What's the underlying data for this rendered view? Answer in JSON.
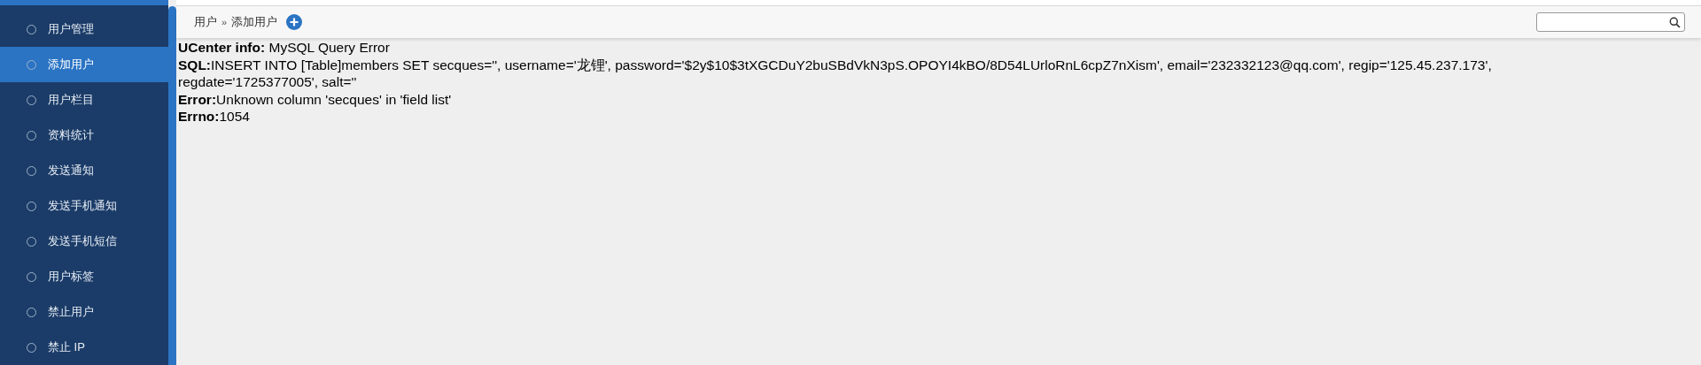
{
  "sidebar": {
    "items": [
      {
        "label": "用户管理",
        "selected": false
      },
      {
        "label": "添加用户",
        "selected": true
      },
      {
        "label": "用户栏目",
        "selected": false
      },
      {
        "label": "资料统计",
        "selected": false
      },
      {
        "label": "发送通知",
        "selected": false
      },
      {
        "label": "发送手机通知",
        "selected": false
      },
      {
        "label": "发送手机短信",
        "selected": false
      },
      {
        "label": "用户标签",
        "selected": false
      },
      {
        "label": "禁止用户",
        "selected": false
      },
      {
        "label": "禁止 IP",
        "selected": false
      }
    ]
  },
  "breadcrumb": {
    "items": [
      "用户",
      "添加用户"
    ],
    "separator": "»"
  },
  "error_lines": [
    "**UCenter info:** MySQL Query Error",
    "**SQL:**INSERT INTO [Table]members SET secques='', username='龙锂', password='$2y$10$3tXGCDuY2buSBdVkN3pS.OPOYI4kBO/8D54LUrloRnL6cpZ7nXism', email='232332123@qq.com', regip='125.45.237.173', regdate='1725377005', salt=''",
    "**Error:**Unknown column 'secques' in 'field list'",
    "**Errno:**1054"
  ]
}
